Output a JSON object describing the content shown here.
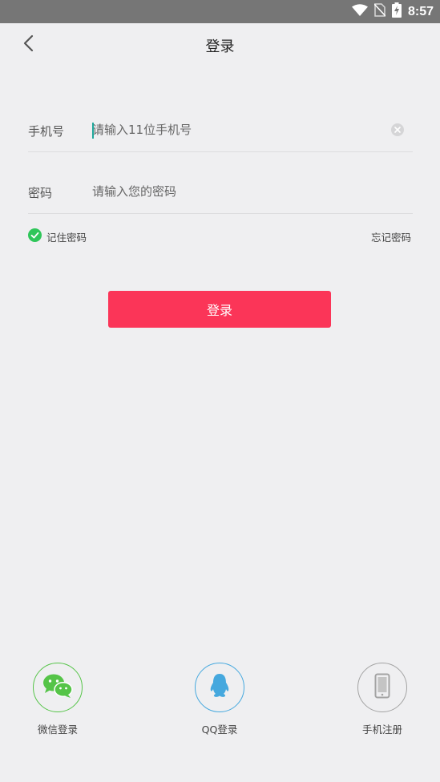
{
  "status_bar": {
    "time": "8:57",
    "icons": [
      "wifi-icon",
      "no-sim-icon",
      "battery-charging-icon"
    ]
  },
  "header": {
    "back_icon": "chevron-left-icon",
    "title": "登录"
  },
  "phone_field": {
    "label": "手机号",
    "placeholder": "请输入11位手机号",
    "value": "",
    "clear_icon": "clear-icon"
  },
  "password_field": {
    "label": "密码",
    "placeholder": "请输入您的密码",
    "value": ""
  },
  "options": {
    "remember_label": "记住密码",
    "remember_checked": true,
    "forgot_label": "忘记密码"
  },
  "login_button": {
    "label": "登录"
  },
  "social_logins": [
    {
      "label": "微信登录",
      "icon": "wechat-icon",
      "color": "#55c448"
    },
    {
      "label": "QQ登录",
      "icon": "qq-penguin-icon",
      "color": "#45a8de"
    },
    {
      "label": "手机注册",
      "icon": "phone-icon",
      "color": "#a3a3a3"
    }
  ],
  "colors": {
    "accent": "#fb3558",
    "background": "#efeff1",
    "status_bar": "#767676",
    "check": "#2fc65a"
  }
}
